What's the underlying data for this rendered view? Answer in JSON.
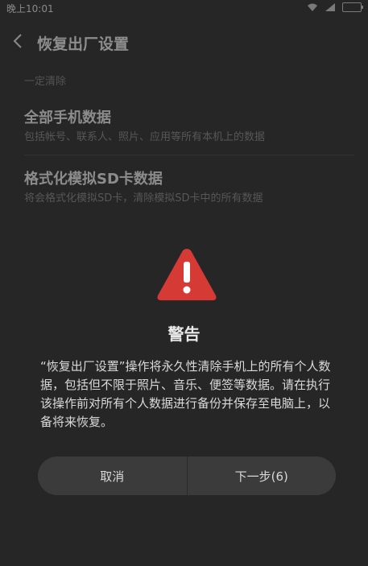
{
  "status_bar": {
    "time": "晚上10:01"
  },
  "header": {
    "title": "恢复出厂设置"
  },
  "settings": {
    "section_label": "一定清除",
    "items": [
      {
        "title": "全部手机数据",
        "description": "包括帐号、联系人、照片、应用等所有本机上的数据"
      },
      {
        "title": "格式化模拟SD卡数据",
        "description": "将会格式化模拟SD卡，清除模拟SD卡中的所有数据"
      }
    ]
  },
  "dialog": {
    "icon": "warning-icon",
    "title": "警告",
    "message": "“恢复出厂设置”操作将永久性清除手机上的所有个人数据，包括但不限于照片、音乐、便签等数据。请在执行该操作前对所有个人数据进行备份并保存至电脑上，以备将来恢复。",
    "cancel_label": "取消",
    "next_label": "下一步(6)"
  },
  "colors": {
    "warning_red": "#d63a35",
    "dialog_button_bg": "#3b3b3b"
  }
}
